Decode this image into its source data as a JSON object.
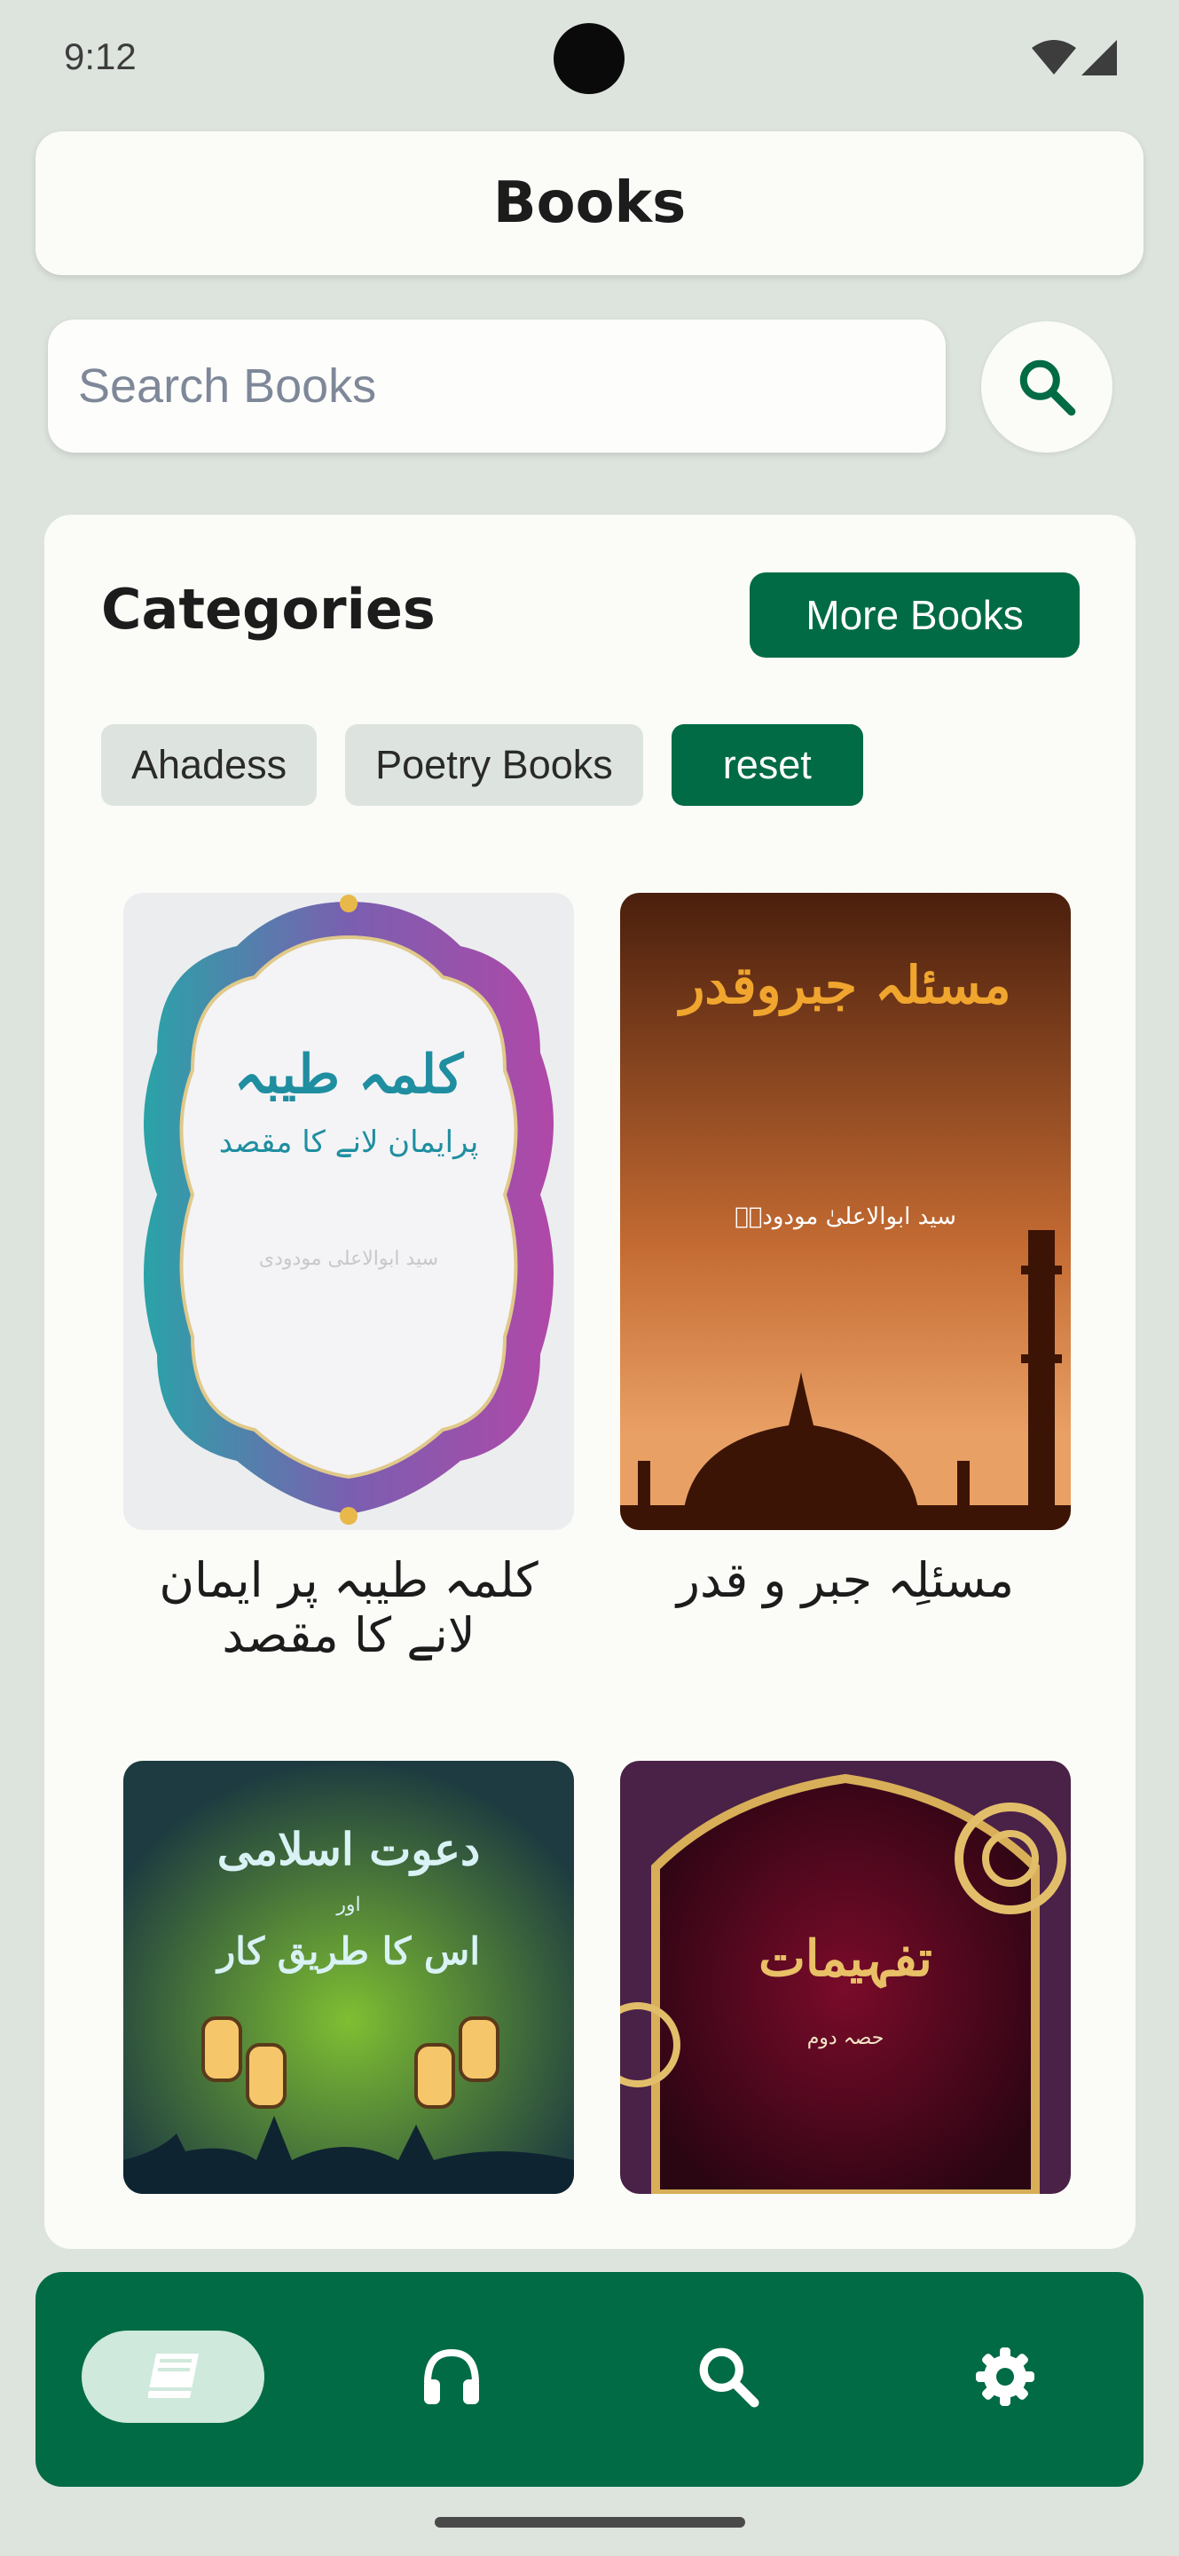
{
  "status_bar": {
    "time": "9:12"
  },
  "header": {
    "title": "Books"
  },
  "search": {
    "placeholder": "Search Books"
  },
  "categories": {
    "title": "Categories",
    "more_label": "More Books",
    "chips": [
      {
        "label": "Ahadess",
        "active": false
      },
      {
        "label": "Poetry Books",
        "active": false
      },
      {
        "label": "reset",
        "active": true
      }
    ]
  },
  "books": [
    {
      "title": "کلمہ طیبہ پر ایمان لانے کا مقصد",
      "cover_title": "کلمہ طیبہ",
      "cover_subtitle": "پرایمان لانے کا مقصد",
      "cover_author": "سید ابوالاعلی مودودی"
    },
    {
      "title": "مسئلِہ جبر و قدر",
      "cover_title": "مسئلہ جبروقدر",
      "cover_author": "سید ابوالاعلیٰ مودودیؒ"
    },
    {
      "cover_title": "دعوت اسلامی",
      "cover_mid": "اور",
      "cover_subtitle": "اس کا طریق کار"
    },
    {
      "cover_title": "تفہیمات",
      "cover_subtitle": "حصہ دوم"
    }
  ],
  "nav": {
    "items": [
      "books-icon",
      "headphones-icon",
      "search-icon",
      "gear-icon"
    ],
    "active_index": 0
  },
  "colors": {
    "primary": "#006b45",
    "background": "#dde4de",
    "card": "#fbfcf8"
  }
}
